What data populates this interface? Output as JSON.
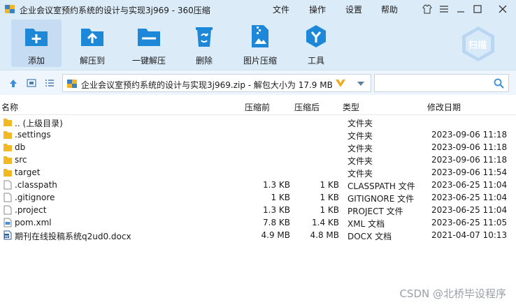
{
  "window": {
    "title": "企业会议室预约系统的设计与实现3j969 - 360压缩",
    "menus": [
      "文件",
      "操作",
      "设置",
      "帮助"
    ]
  },
  "toolbar": {
    "add": "添加",
    "extract_to": "解压到",
    "one_click_extract": "一键解压",
    "delete": "删除",
    "image_compress": "图片压缩",
    "tools": "工具",
    "scan": "扫描"
  },
  "address": {
    "path": "企业会议室预约系统的设计与实现3j969.zip - 解包大小为 17.9 MB",
    "search_placeholder": ""
  },
  "columns": {
    "name": "名称",
    "size": "压缩前",
    "packed": "压缩后",
    "type": "类型",
    "modified": "修改日期"
  },
  "files": [
    {
      "name": ".. (上级目录)",
      "size": "",
      "packed": "",
      "type": "文件夹",
      "date": "",
      "icon": "folder-icon"
    },
    {
      "name": ".settings",
      "size": "",
      "packed": "",
      "type": "文件夹",
      "date": "2023-09-06 11:18",
      "icon": "folder-icon"
    },
    {
      "name": "db",
      "size": "",
      "packed": "",
      "type": "文件夹",
      "date": "2023-09-06 11:18",
      "icon": "folder-icon"
    },
    {
      "name": "src",
      "size": "",
      "packed": "",
      "type": "文件夹",
      "date": "2023-09-06 11:18",
      "icon": "folder-icon"
    },
    {
      "name": "target",
      "size": "",
      "packed": "",
      "type": "文件夹",
      "date": "2023-09-06 11:54",
      "icon": "folder-icon"
    },
    {
      "name": ".classpath",
      "size": "1.3 KB",
      "packed": "1 KB",
      "type": "CLASSPATH 文件",
      "date": "2023-06-25 11:04",
      "icon": "file-icon"
    },
    {
      "name": ".gitignore",
      "size": "1 KB",
      "packed": "1 KB",
      "type": "GITIGNORE 文件",
      "date": "2023-06-25 11:04",
      "icon": "file-icon"
    },
    {
      "name": ".project",
      "size": "1.3 KB",
      "packed": "1 KB",
      "type": "PROJECT 文件",
      "date": "2023-06-25 11:04",
      "icon": "file-icon"
    },
    {
      "name": "pom.xml",
      "size": "7.8 KB",
      "packed": "1.4 KB",
      "type": "XML 文档",
      "date": "2023-06-25 11:05",
      "icon": "xml-file-icon"
    },
    {
      "name": "期刊在线投稿系统q2ud0.docx",
      "size": "4.9 MB",
      "packed": "4.8 MB",
      "type": "DOCX 文档",
      "date": "2021-04-07 10:13",
      "icon": "word-doc-icon"
    }
  ],
  "watermark": "CSDN @北桥毕设程序",
  "colors": {
    "chrome_bg": "#dcebf8",
    "accent_blue": "#1e88d8",
    "folder_yellow": "#f2b925"
  }
}
